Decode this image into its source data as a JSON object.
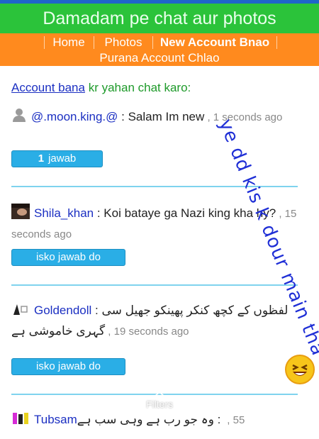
{
  "header": {
    "title": "Damadam pe chat aur photos"
  },
  "nav": {
    "home": "Home",
    "photos": "Photos",
    "new_account": "New Account Bnao",
    "old_account": "Purana Account Chlao"
  },
  "intro": {
    "link": "Account bana",
    "text": " kr yahan chat karo:"
  },
  "posts": [
    {
      "username": "@.moon.king.@",
      "message": " : Salam Im new",
      "time": " , 1 seconds ago",
      "reply_count": "1",
      "reply_label": "jawab"
    },
    {
      "username": "Shila_khan",
      "message": " : Koi bataye ga Nazi king kha hy?",
      "time": " , 15 seconds ago",
      "reply_label": "isko jawab do"
    },
    {
      "username": "Goldendoll",
      "message": "لفظوں کے کچھ کنکر پھینکو جھیل سی گہری خاموشی ہے",
      "time": " , 19 seconds ago",
      "reply_label": "isko jawab do"
    },
    {
      "username": "Tubsam",
      "message": " : وہ جو رب ہے وہی سب ہے",
      "time": " , 55"
    }
  ],
  "overlay": {
    "handwritten_note": "ye dd kis k dour main tha",
    "filters_label": "Filters"
  },
  "colors": {
    "header_green": "#2bc33a",
    "nav_orange": "#ff8a1e",
    "link_blue": "#1b2fc2",
    "button_blue": "#2aaee6"
  }
}
